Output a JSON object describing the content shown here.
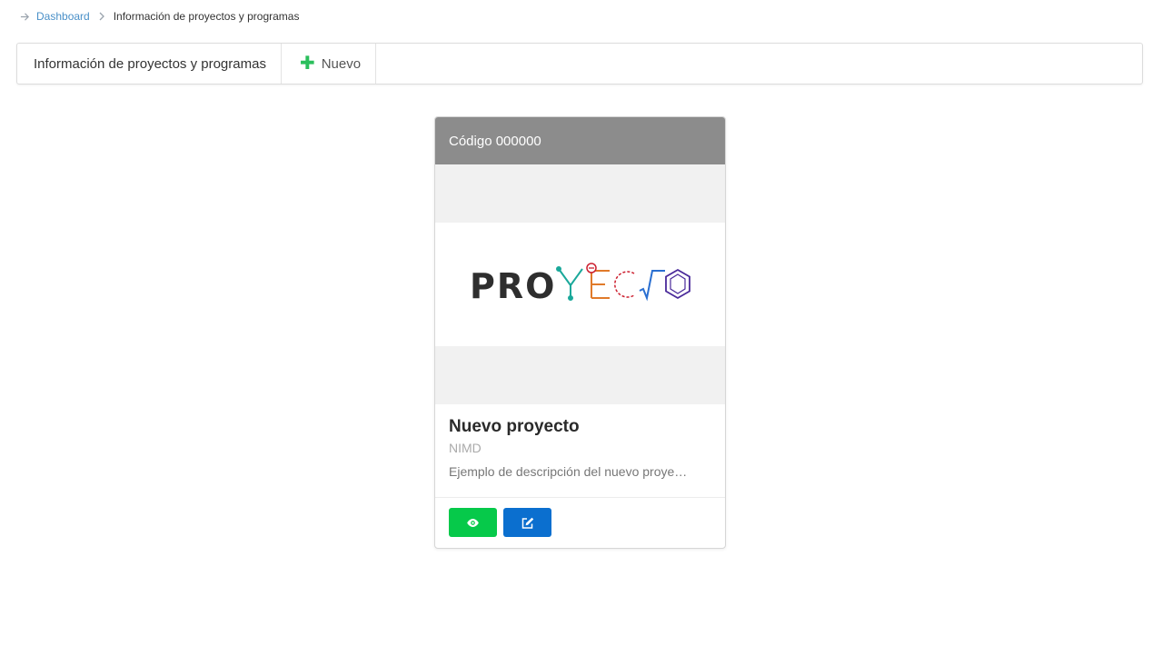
{
  "breadcrumb": {
    "root": "Dashboard",
    "current": "Información de proyectos y programas"
  },
  "toolbar": {
    "title": "Información de proyectos y programas",
    "new_label": "Nuevo"
  },
  "card": {
    "code": "Código 000000",
    "logo_text": "PROYECTO",
    "name": "Nuevo proyecto",
    "org": "NIMD",
    "description": "Ejemplo de descripción del nuevo proye…",
    "view_icon": "eye-icon",
    "edit_icon": "edit-icon"
  },
  "colors": {
    "accent_green": "#06c94a",
    "accent_blue": "#0b6fcf",
    "header_gray": "#8c8c8c",
    "link": "#4a90c8"
  }
}
